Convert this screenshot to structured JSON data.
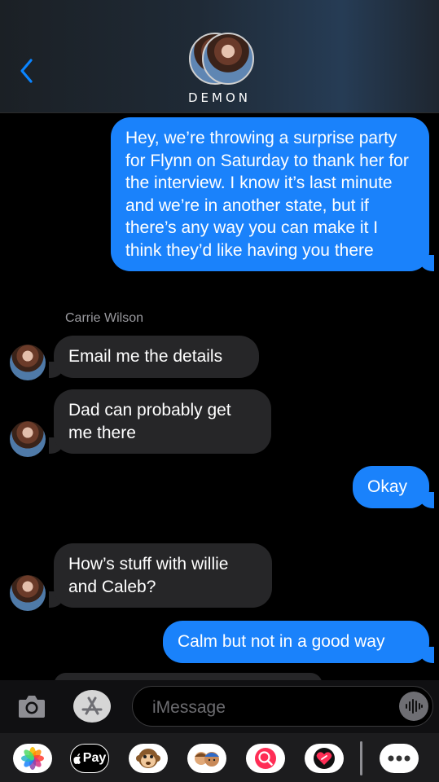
{
  "header": {
    "back_icon": "chevron-left-icon",
    "contact_name": "DEMON"
  },
  "messages": [
    {
      "direction": "outgoing",
      "text": "Hey, we’re throwing a surprise party for Flynn on Saturday to thank her for the interview. I know it’s last minute and we’re in another state, but if there’s any way you can make it I think they’d like having you there"
    },
    {
      "direction": "incoming",
      "sender": "Carrie Wilson",
      "text": "Email me the details"
    },
    {
      "direction": "incoming",
      "text": "Dad can probably get me there"
    },
    {
      "direction": "outgoing",
      "text": "Okay"
    },
    {
      "direction": "incoming",
      "text": "How’s stuff with willie and Caleb?"
    },
    {
      "direction": "outgoing",
      "text": "Calm but not in a good way"
    }
  ],
  "composer": {
    "placeholder": "iMessage",
    "value": ""
  },
  "apps": [
    {
      "name": "photos-app-icon"
    },
    {
      "name": "apple-pay-icon",
      "label": "Pay"
    },
    {
      "name": "animoji-monkey-icon"
    },
    {
      "name": "memoji-icon"
    },
    {
      "name": "image-search-icon"
    },
    {
      "name": "digital-touch-icon"
    },
    {
      "name": "more-apps-icon"
    }
  ],
  "colors": {
    "outgoing_bubble": "#1a82fb",
    "incoming_bubble": "#262628",
    "accent": "#0a84ff"
  }
}
